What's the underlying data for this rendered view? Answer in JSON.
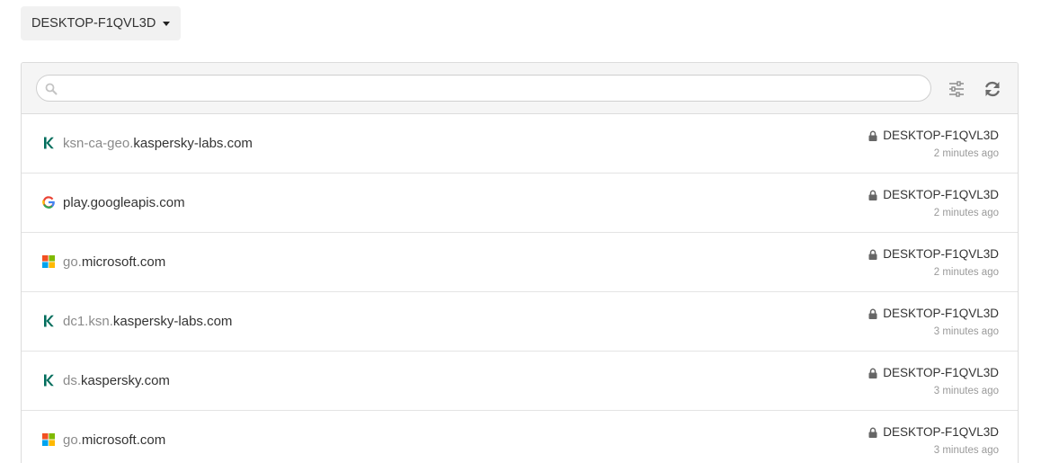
{
  "device_selector": {
    "label": "DESKTOP-F1QVL3D"
  },
  "search": {
    "placeholder": "",
    "value": ""
  },
  "toolbar": {
    "filter_icon": "sliders-icon",
    "refresh_icon": "refresh-icon"
  },
  "rows": [
    {
      "icon": "kaspersky-icon",
      "subdomain": "ksn-ca-geo.",
      "domain": "kaspersky-labs.com",
      "host": "DESKTOP-F1QVL3D",
      "time": "2 minutes ago"
    },
    {
      "icon": "google-icon",
      "subdomain": "",
      "domain": "play.googleapis.com",
      "host": "DESKTOP-F1QVL3D",
      "time": "2 minutes ago"
    },
    {
      "icon": "microsoft-icon",
      "subdomain": "go.",
      "domain": "microsoft.com",
      "host": "DESKTOP-F1QVL3D",
      "time": "2 minutes ago"
    },
    {
      "icon": "kaspersky-icon",
      "subdomain": "dc1.ksn.",
      "domain": "kaspersky-labs.com",
      "host": "DESKTOP-F1QVL3D",
      "time": "3 minutes ago"
    },
    {
      "icon": "kaspersky-icon",
      "subdomain": "ds.",
      "domain": "kaspersky.com",
      "host": "DESKTOP-F1QVL3D",
      "time": "3 minutes ago"
    },
    {
      "icon": "microsoft-icon",
      "subdomain": "go.",
      "domain": "microsoft.com",
      "host": "DESKTOP-F1QVL3D",
      "time": "3 minutes ago"
    }
  ],
  "colors": {
    "kaspersky": "#006d5c",
    "google_blue": "#4285f4",
    "google_red": "#ea4335",
    "google_yellow": "#fbbc05",
    "google_green": "#34a853",
    "ms_red": "#f25022",
    "ms_green": "#7fba00",
    "ms_blue": "#00a4ef",
    "ms_yellow": "#ffb900"
  }
}
